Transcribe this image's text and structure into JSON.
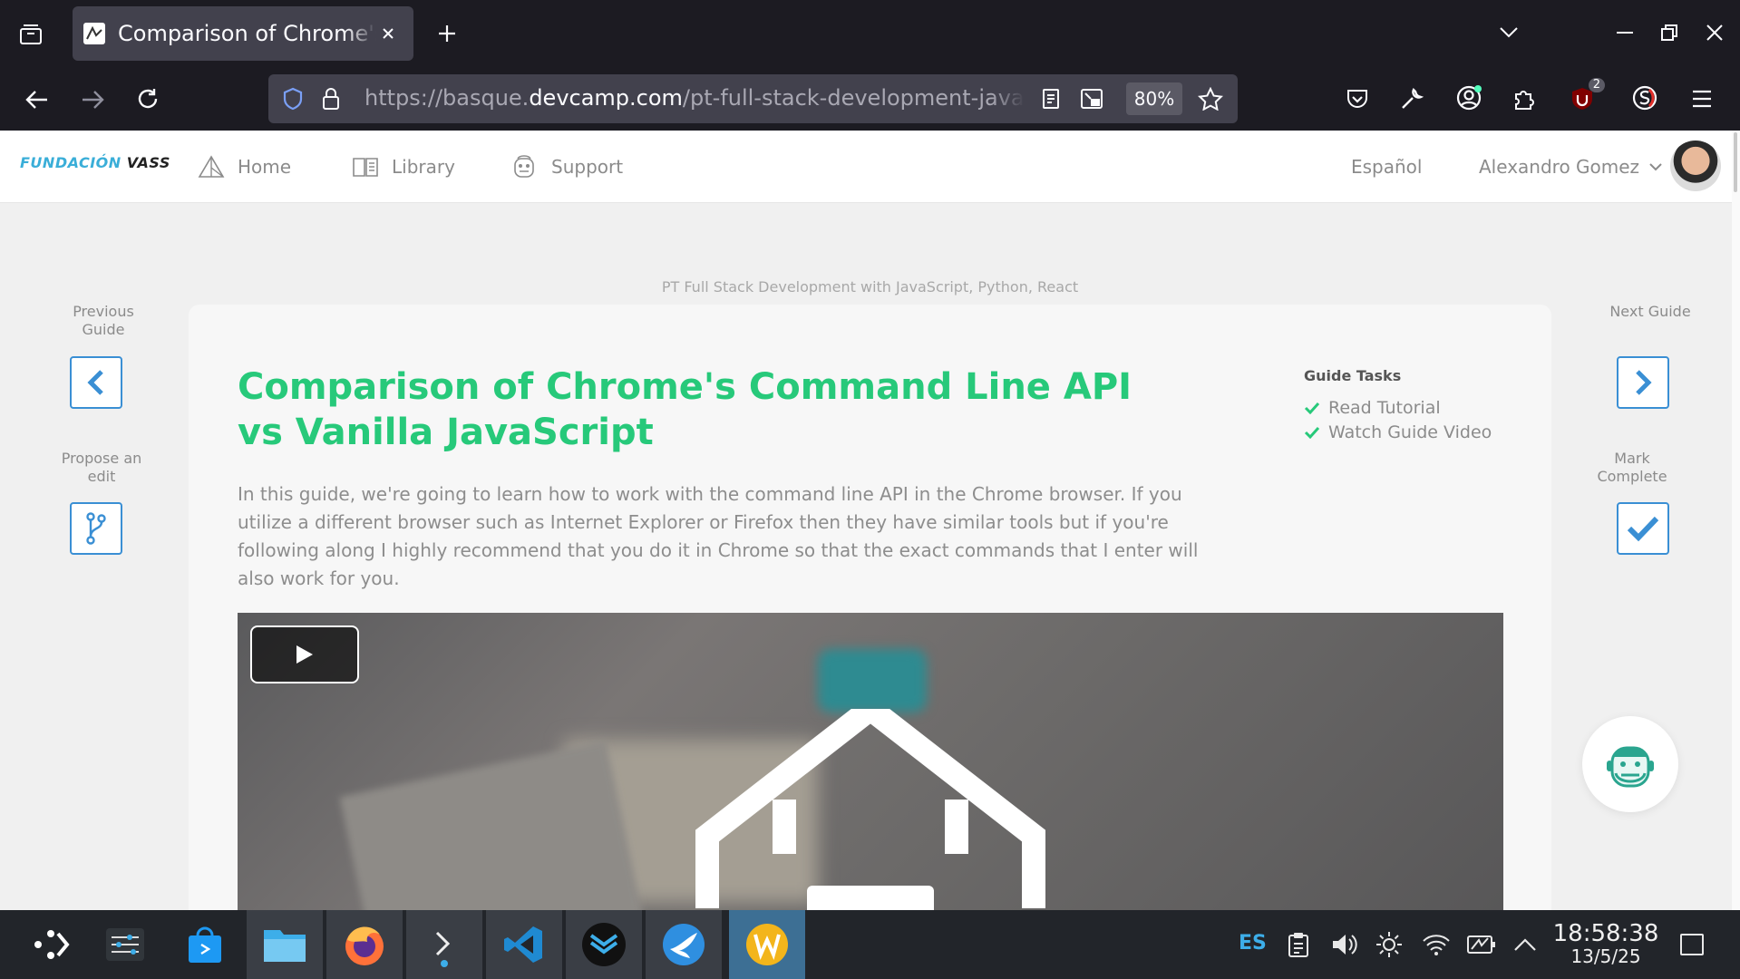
{
  "browser": {
    "tab_title": "Comparison of Chrome's Command Line API vs Vanilla JavaScript",
    "url_prefix": "https://basque.",
    "url_host": "devcamp.com",
    "url_path": "/pt-full-stack-development-javascript-python-react/guide/comparison-chrome-command-line-api-vanilla-javascript",
    "zoom": "80%",
    "extension_badge": "2"
  },
  "nav": {
    "logo_part1": "FUNDACIÓN",
    "logo_part2": "VASS",
    "home": "Home",
    "library": "Library",
    "support": "Support",
    "language": "Español",
    "user": "Alexandro Gomez"
  },
  "guide": {
    "course": "PT Full Stack Development with JavaScript, Python, React",
    "title": "Comparison of Chrome's Command Line API vs Vanilla JavaScript",
    "description": "In this guide, we're going to learn how to work with the command line API in the Chrome browser. If you utilize a different browser such as Internet Explorer or Firefox then they have similar tools but if you're following along I highly recommend that you do it in Chrome so that the exact commands that I enter will also work for you.",
    "tasks_heading": "Guide Tasks",
    "tasks": [
      "Read Tutorial",
      "Watch Guide Video"
    ],
    "prev_label": "Previous Guide",
    "propose_label": "Propose an edit",
    "next_label": "Next Guide",
    "complete_label": "Mark Complete"
  },
  "colors": {
    "accent_green": "#27c97a",
    "accent_blue": "#3a8fd4",
    "chrome_dark": "#1c1b22"
  },
  "taskbar": {
    "language": "ES",
    "time": "18:58:38",
    "date": "13/5/25"
  }
}
